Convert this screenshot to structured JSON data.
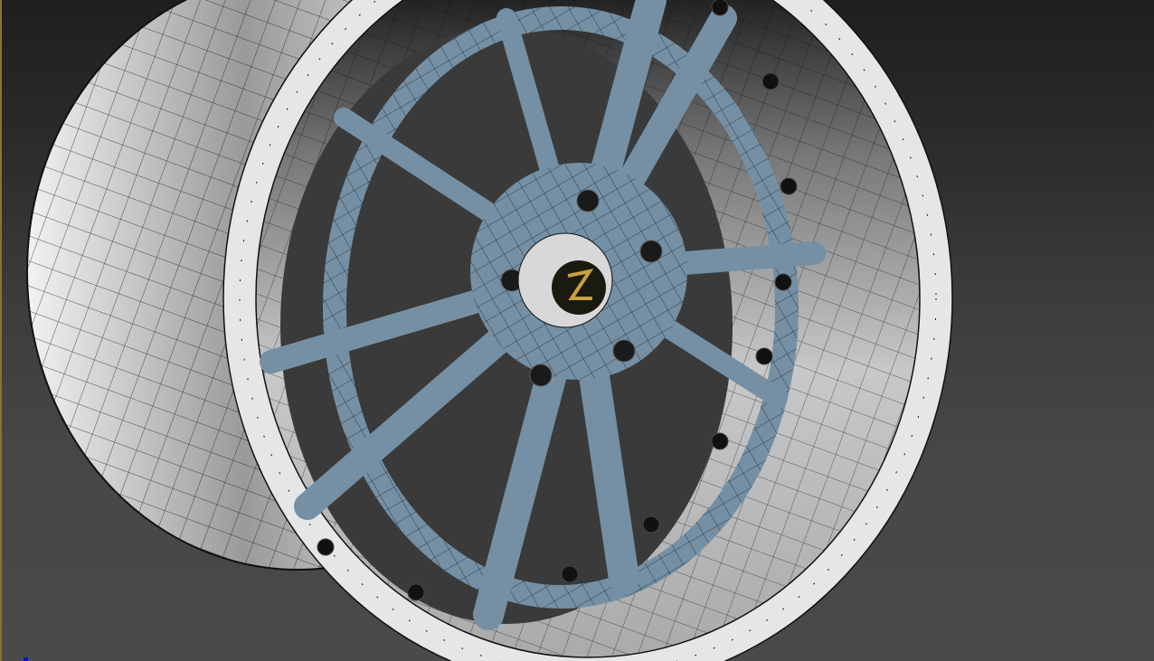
{
  "viewport": {
    "colors": {
      "active_border": "#8a7430",
      "rim": "#d8d8d8",
      "spokes": "#7590a4",
      "wire": "#000000",
      "cap": "#1a1a10",
      "cap_logo": "#c8a040"
    },
    "model": {
      "spoke_count": 10,
      "bolt_count": 18
    }
  }
}
